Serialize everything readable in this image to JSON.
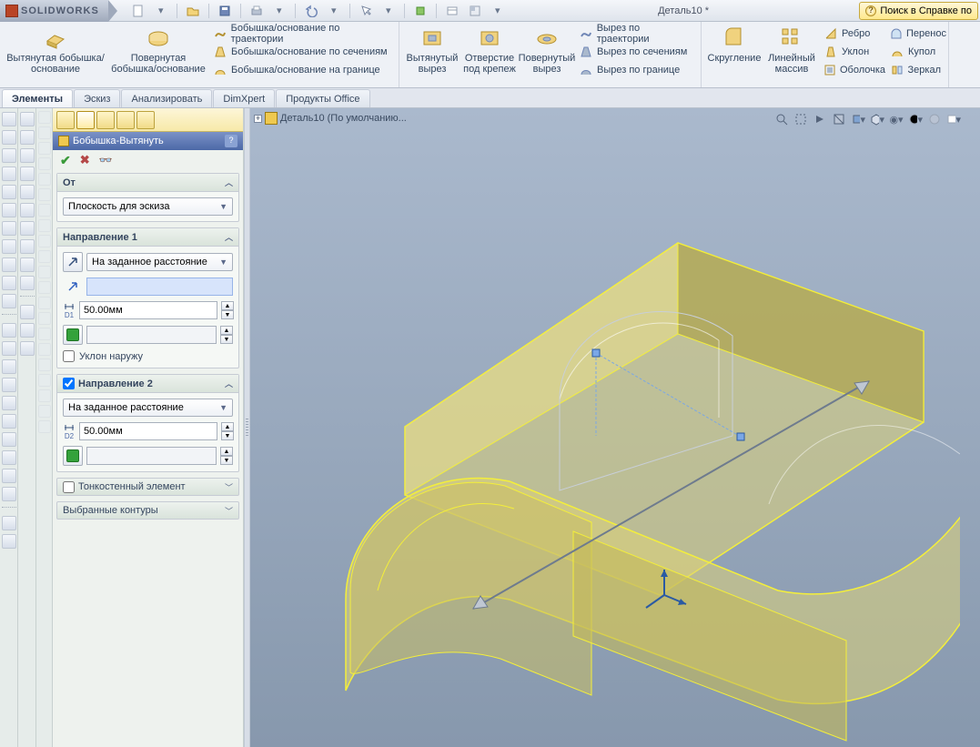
{
  "app_logo": "SOLIDWORKS",
  "document_title": "Деталь10 *",
  "help_search_placeholder": "Поиск в Справке по",
  "quick_access": [
    "new",
    "open",
    "save",
    "print",
    "undo",
    "select",
    "rebuild",
    "options",
    "appearance"
  ],
  "ribbon": {
    "extrude_boss": {
      "label": "Вытянутая бобышка/основание"
    },
    "revolve_boss": {
      "label": "Повернутая бобышка/основание"
    },
    "boss_sweep": {
      "label": "Бобышка/основание по траектории"
    },
    "boss_loft": {
      "label": "Бобышка/основание по сечениям"
    },
    "boss_boundary": {
      "label": "Бобышка/основание на границе"
    },
    "extrude_cut": {
      "label": "Вытянутый вырез"
    },
    "hole_wizard": {
      "label": "Отверстие под крепеж"
    },
    "revolve_cut": {
      "label": "Повернутый вырез"
    },
    "cut_sweep": {
      "label": "Вырез по траектории"
    },
    "cut_loft": {
      "label": "Вырез по сечениям"
    },
    "cut_boundary": {
      "label": "Вырез по границе"
    },
    "fillet": {
      "label": "Скругление"
    },
    "linear_pattern": {
      "label": "Линейный массив"
    },
    "rib": {
      "label": "Ребро"
    },
    "draft": {
      "label": "Уклон"
    },
    "shell": {
      "label": "Оболочка"
    },
    "intersect": {
      "label": "Перенос"
    },
    "dome": {
      "label": "Купол"
    },
    "mirror": {
      "label": "Зеркал"
    }
  },
  "tabs": {
    "features": "Элементы",
    "sketch": "Эскиз",
    "evaluate": "Анализировать",
    "dimxpert": "DimXpert",
    "office": "Продукты Office"
  },
  "breadcrumb": {
    "part": "Деталь10",
    "config": "(По умолчанию..."
  },
  "property_manager": {
    "title": "Бобышка-Вытянуть",
    "from_header": "От",
    "from_option": "Плоскость для эскиза",
    "dir1_header": "Направление 1",
    "dir1_end_condition": "На заданное расстояние",
    "dir1_distance": "50.00мм",
    "dir1_draft_outward": "Уклон наружу",
    "dir2_header": "Направление 2",
    "dir2_checked": true,
    "dir2_end_condition": "На заданное расстояние",
    "dir2_distance": "50.00мм",
    "thin_header": "Тонкостенный элемент",
    "contours_header": "Выбранные контуры",
    "d1_label": "D1",
    "d2_label": "D2"
  },
  "view_toolbar": [
    "zoom-fit",
    "zoom-area",
    "prev-view",
    "section",
    "display-style",
    "view-orient",
    "hide-show",
    "edit-appearance",
    "apply-scene",
    "view-settings"
  ]
}
